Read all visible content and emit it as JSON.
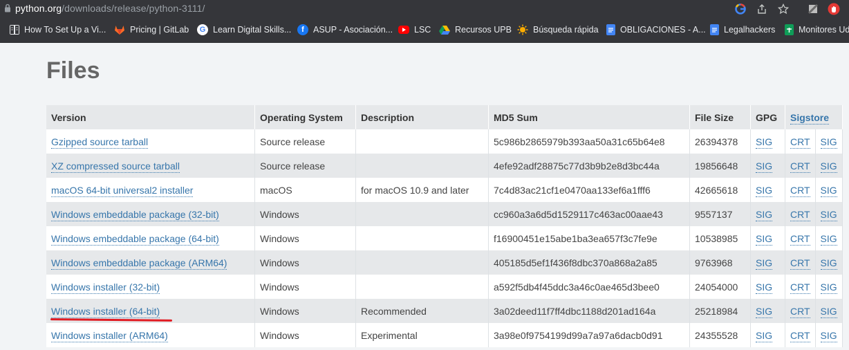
{
  "browser": {
    "url_host": "python.org",
    "url_path": "/downloads/release/python-3111/"
  },
  "bookmarks": [
    {
      "label": "How To Set Up a Vi...",
      "icon": "reading-list-icon"
    },
    {
      "label": "Pricing | GitLab",
      "icon": "gitlab-icon"
    },
    {
      "label": "Learn Digital Skills...",
      "icon": "google-icon"
    },
    {
      "label": "ASUP - Asociación...",
      "icon": "facebook-icon"
    },
    {
      "label": "LSC",
      "icon": "youtube-icon"
    },
    {
      "label": "Recursos UPB",
      "icon": "google-drive-icon"
    },
    {
      "label": "Búsqueda rápida",
      "icon": "sun-icon"
    },
    {
      "label": "OBLIGACIONES - A...",
      "icon": "google-docs-icon"
    },
    {
      "label": "Legalhackers",
      "icon": "google-docs-icon"
    },
    {
      "label": "Monitores Ud",
      "icon": "google-sheets-icon"
    }
  ],
  "page": {
    "title": "Files"
  },
  "table": {
    "headers": {
      "version": "Version",
      "os": "Operating System",
      "description": "Description",
      "md5": "MD5 Sum",
      "size": "File Size",
      "gpg": "GPG",
      "sigstore": "Sigstore"
    },
    "rows": [
      {
        "version": "Gzipped source tarball",
        "os": "Source release",
        "description": "",
        "md5": "5c986b2865979b393aa50a31c65b64e8",
        "size": "26394378",
        "gpg": "SIG",
        "crt": "CRT",
        "sig": "SIG"
      },
      {
        "version": "XZ compressed source tarball",
        "os": "Source release",
        "description": "",
        "md5": "4efe92adf28875c77d3b9b2e8d3bc44a",
        "size": "19856648",
        "gpg": "SIG",
        "crt": "CRT",
        "sig": "SIG"
      },
      {
        "version": "macOS 64-bit universal2 installer",
        "os": "macOS",
        "description": "for macOS 10.9 and later",
        "md5": "7c4d83ac21cf1e0470aa133ef6a1fff6",
        "size": "42665618",
        "gpg": "SIG",
        "crt": "CRT",
        "sig": "SIG"
      },
      {
        "version": "Windows embeddable package (32-bit)",
        "os": "Windows",
        "description": "",
        "md5": "cc960a3a6d5d1529117c463ac00aae43",
        "size": "9557137",
        "gpg": "SIG",
        "crt": "CRT",
        "sig": "SIG"
      },
      {
        "version": "Windows embeddable package (64-bit)",
        "os": "Windows",
        "description": "",
        "md5": "f16900451e15abe1ba3ea657f3c7fe9e",
        "size": "10538985",
        "gpg": "SIG",
        "crt": "CRT",
        "sig": "SIG"
      },
      {
        "version": "Windows embeddable package (ARM64)",
        "os": "Windows",
        "description": "",
        "md5": "405185d5ef1f436f8dbc370a868a2a85",
        "size": "9763968",
        "gpg": "SIG",
        "crt": "CRT",
        "sig": "SIG"
      },
      {
        "version": "Windows installer (32-bit)",
        "os": "Windows",
        "description": "",
        "md5": "a592f5db4f45ddc3a46c0ae465d3bee0",
        "size": "24054000",
        "gpg": "SIG",
        "crt": "CRT",
        "sig": "SIG"
      },
      {
        "version": "Windows installer (64-bit)",
        "os": "Windows",
        "description": "Recommended",
        "md5": "3a02deed11f7ff4dbc1188d201ad164a",
        "size": "25218984",
        "gpg": "SIG",
        "crt": "CRT",
        "sig": "SIG"
      },
      {
        "version": "Windows installer (ARM64)",
        "os": "Windows",
        "description": "Experimental",
        "md5": "3a98e0f9754199d99a7a97a6dacb0d91",
        "size": "24355528",
        "gpg": "SIG",
        "crt": "CRT",
        "sig": "SIG"
      }
    ]
  },
  "colors": {
    "link": "#3776ab",
    "annotation_underline": "#e11b22"
  }
}
